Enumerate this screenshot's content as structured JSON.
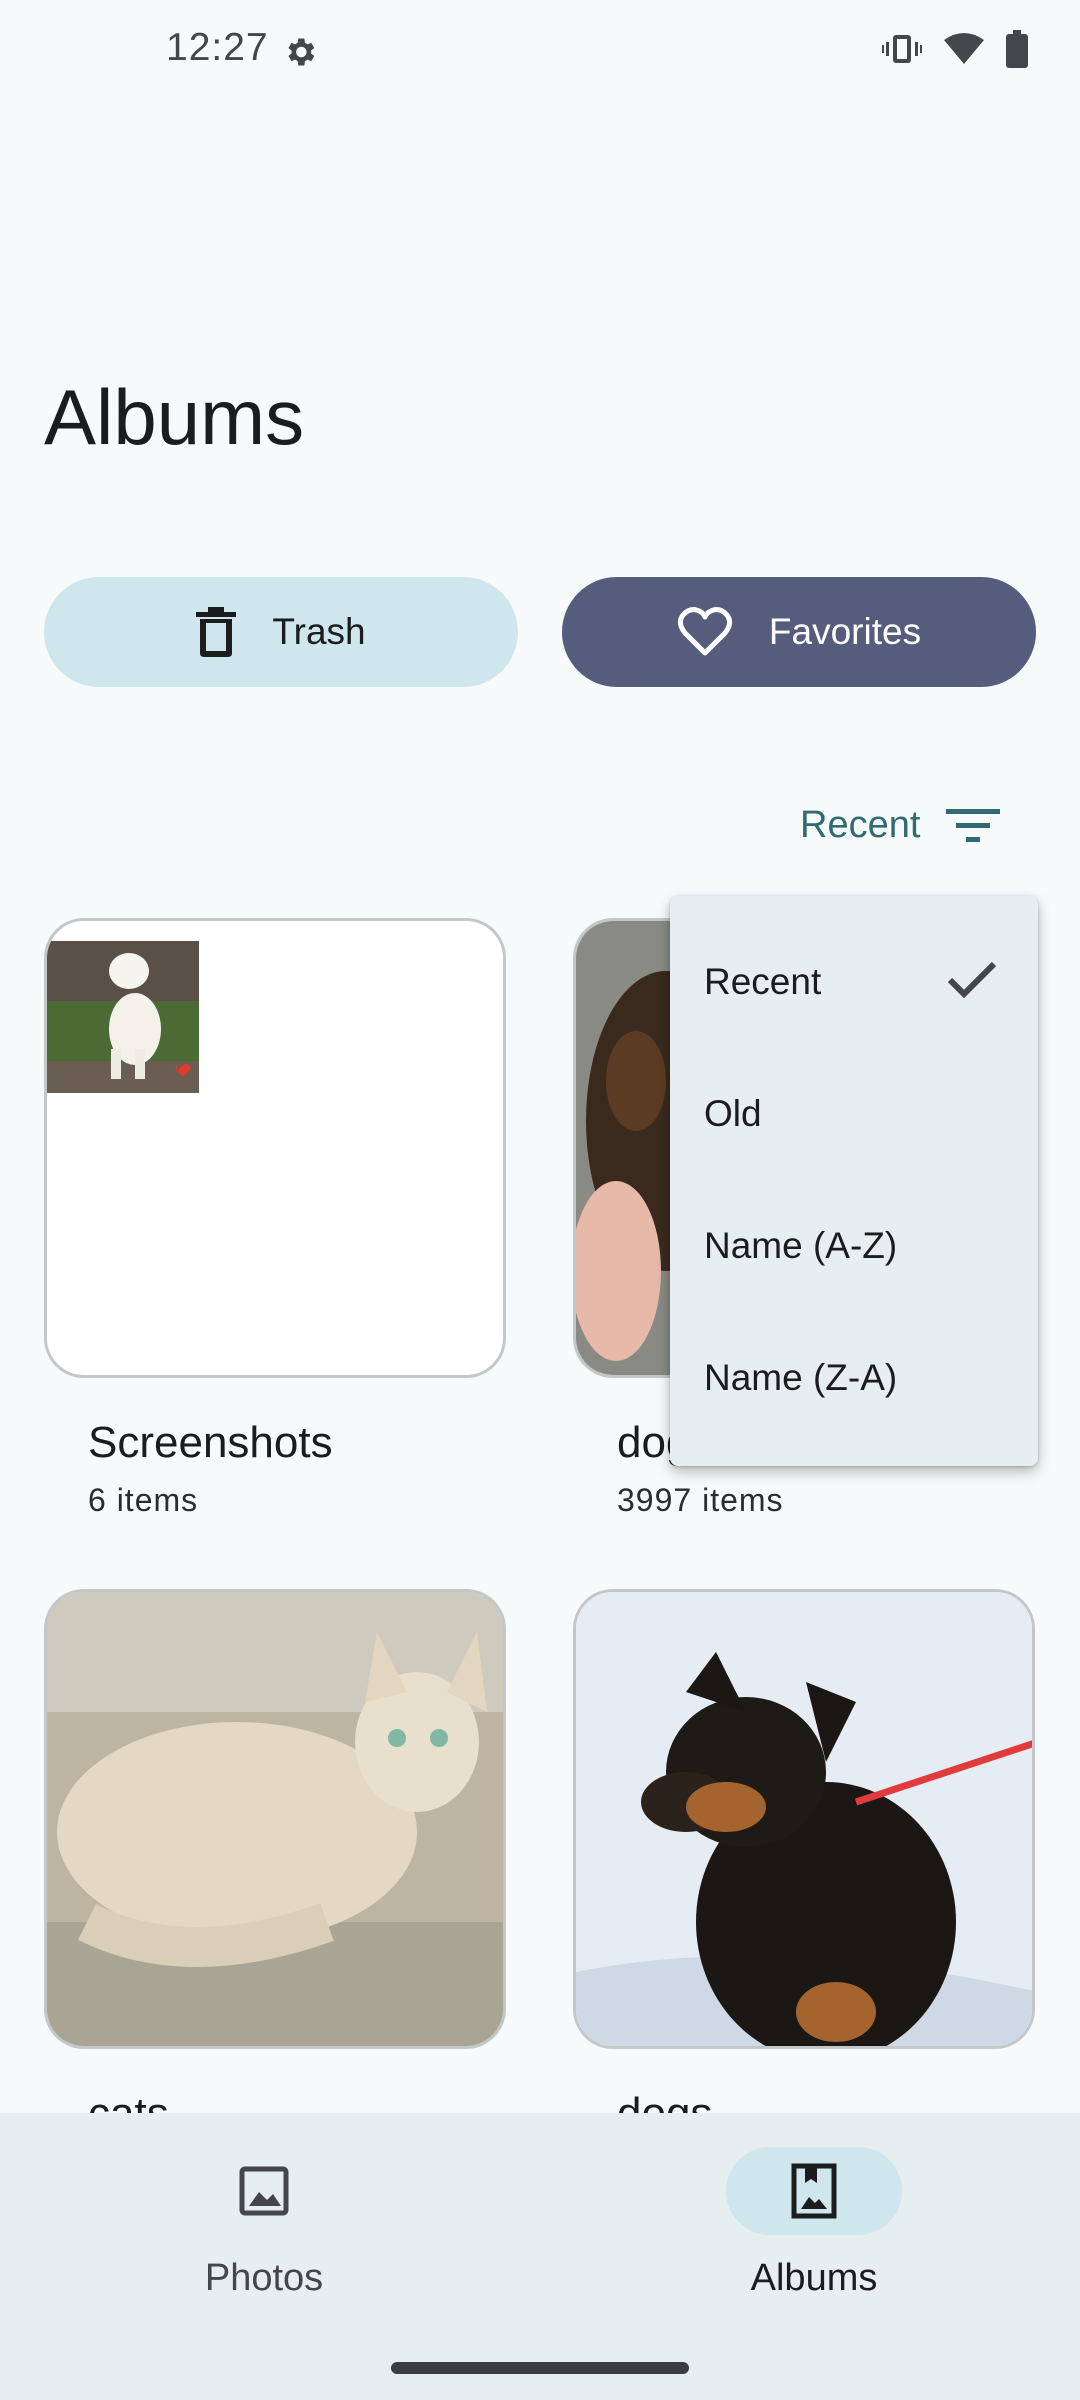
{
  "status_bar": {
    "time": "12:27"
  },
  "page": {
    "title": "Albums"
  },
  "actions": {
    "trash_label": "Trash",
    "favorites_label": "Favorites"
  },
  "sort": {
    "current_label": "Recent",
    "options": [
      "Recent",
      "Old",
      "Name (A-Z)",
      "Name (Z-A)"
    ],
    "selected": "Recent"
  },
  "albums": [
    {
      "name": "Screenshots",
      "count": "6 items"
    },
    {
      "name": "dog",
      "count": "3997 items"
    },
    {
      "name": "cats",
      "count": ""
    },
    {
      "name": "dogs",
      "count": ""
    }
  ],
  "nav": {
    "photos_label": "Photos",
    "albums_label": "Albums",
    "active": "Albums"
  },
  "colors": {
    "accent": "#2f6b70",
    "favorites_bg": "#565c7c",
    "trash_bg": "#cfe6ec",
    "menu_bg": "#e7eef0",
    "nav_bg": "#e6eef0"
  }
}
